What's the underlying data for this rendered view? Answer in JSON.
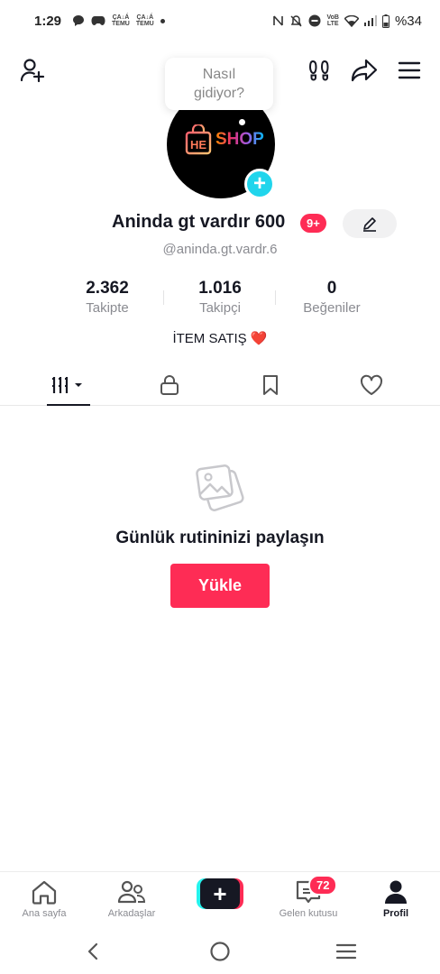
{
  "status_bar": {
    "time": "1:29",
    "temu_label": "TEMU",
    "temu_prefix": "ÇA↓Á",
    "network": "LTE",
    "network_top": "VoB",
    "battery": "%34"
  },
  "tooltip": {
    "text": "Nasıl gidiyor?"
  },
  "avatar": {
    "brand_text": "SHOP",
    "brand_mark": "HE"
  },
  "profile": {
    "display_name": "Aninda gt vardır 600",
    "badge": "9+",
    "username": "@aninda.gt.vardr.6",
    "bio_text": "İTEM SATIŞ",
    "bio_emoji": "❤️"
  },
  "stats": [
    {
      "value": "2.362",
      "label": "Takipte"
    },
    {
      "value": "1.016",
      "label": "Takipçi"
    },
    {
      "value": "0",
      "label": "Beğeniler"
    }
  ],
  "tabs": [
    {
      "name": "videos",
      "icon": "grid-icon"
    },
    {
      "name": "private",
      "icon": "lock-icon"
    },
    {
      "name": "favorites",
      "icon": "bookmark-icon"
    },
    {
      "name": "liked",
      "icon": "heart-icon"
    }
  ],
  "empty_state": {
    "title": "Günlük rutininizi paylaşın",
    "button": "Yükle"
  },
  "bottom_nav": {
    "home": "Ana sayfa",
    "friends": "Arkadaşlar",
    "inbox": "Gelen kutusu",
    "inbox_badge": "72",
    "profile": "Profil"
  },
  "colors": {
    "accent": "#fe2c55",
    "cyan": "#25f4ee",
    "plus_blue": "#20d5ec",
    "text": "#161823",
    "muted": "#8a8b91"
  }
}
